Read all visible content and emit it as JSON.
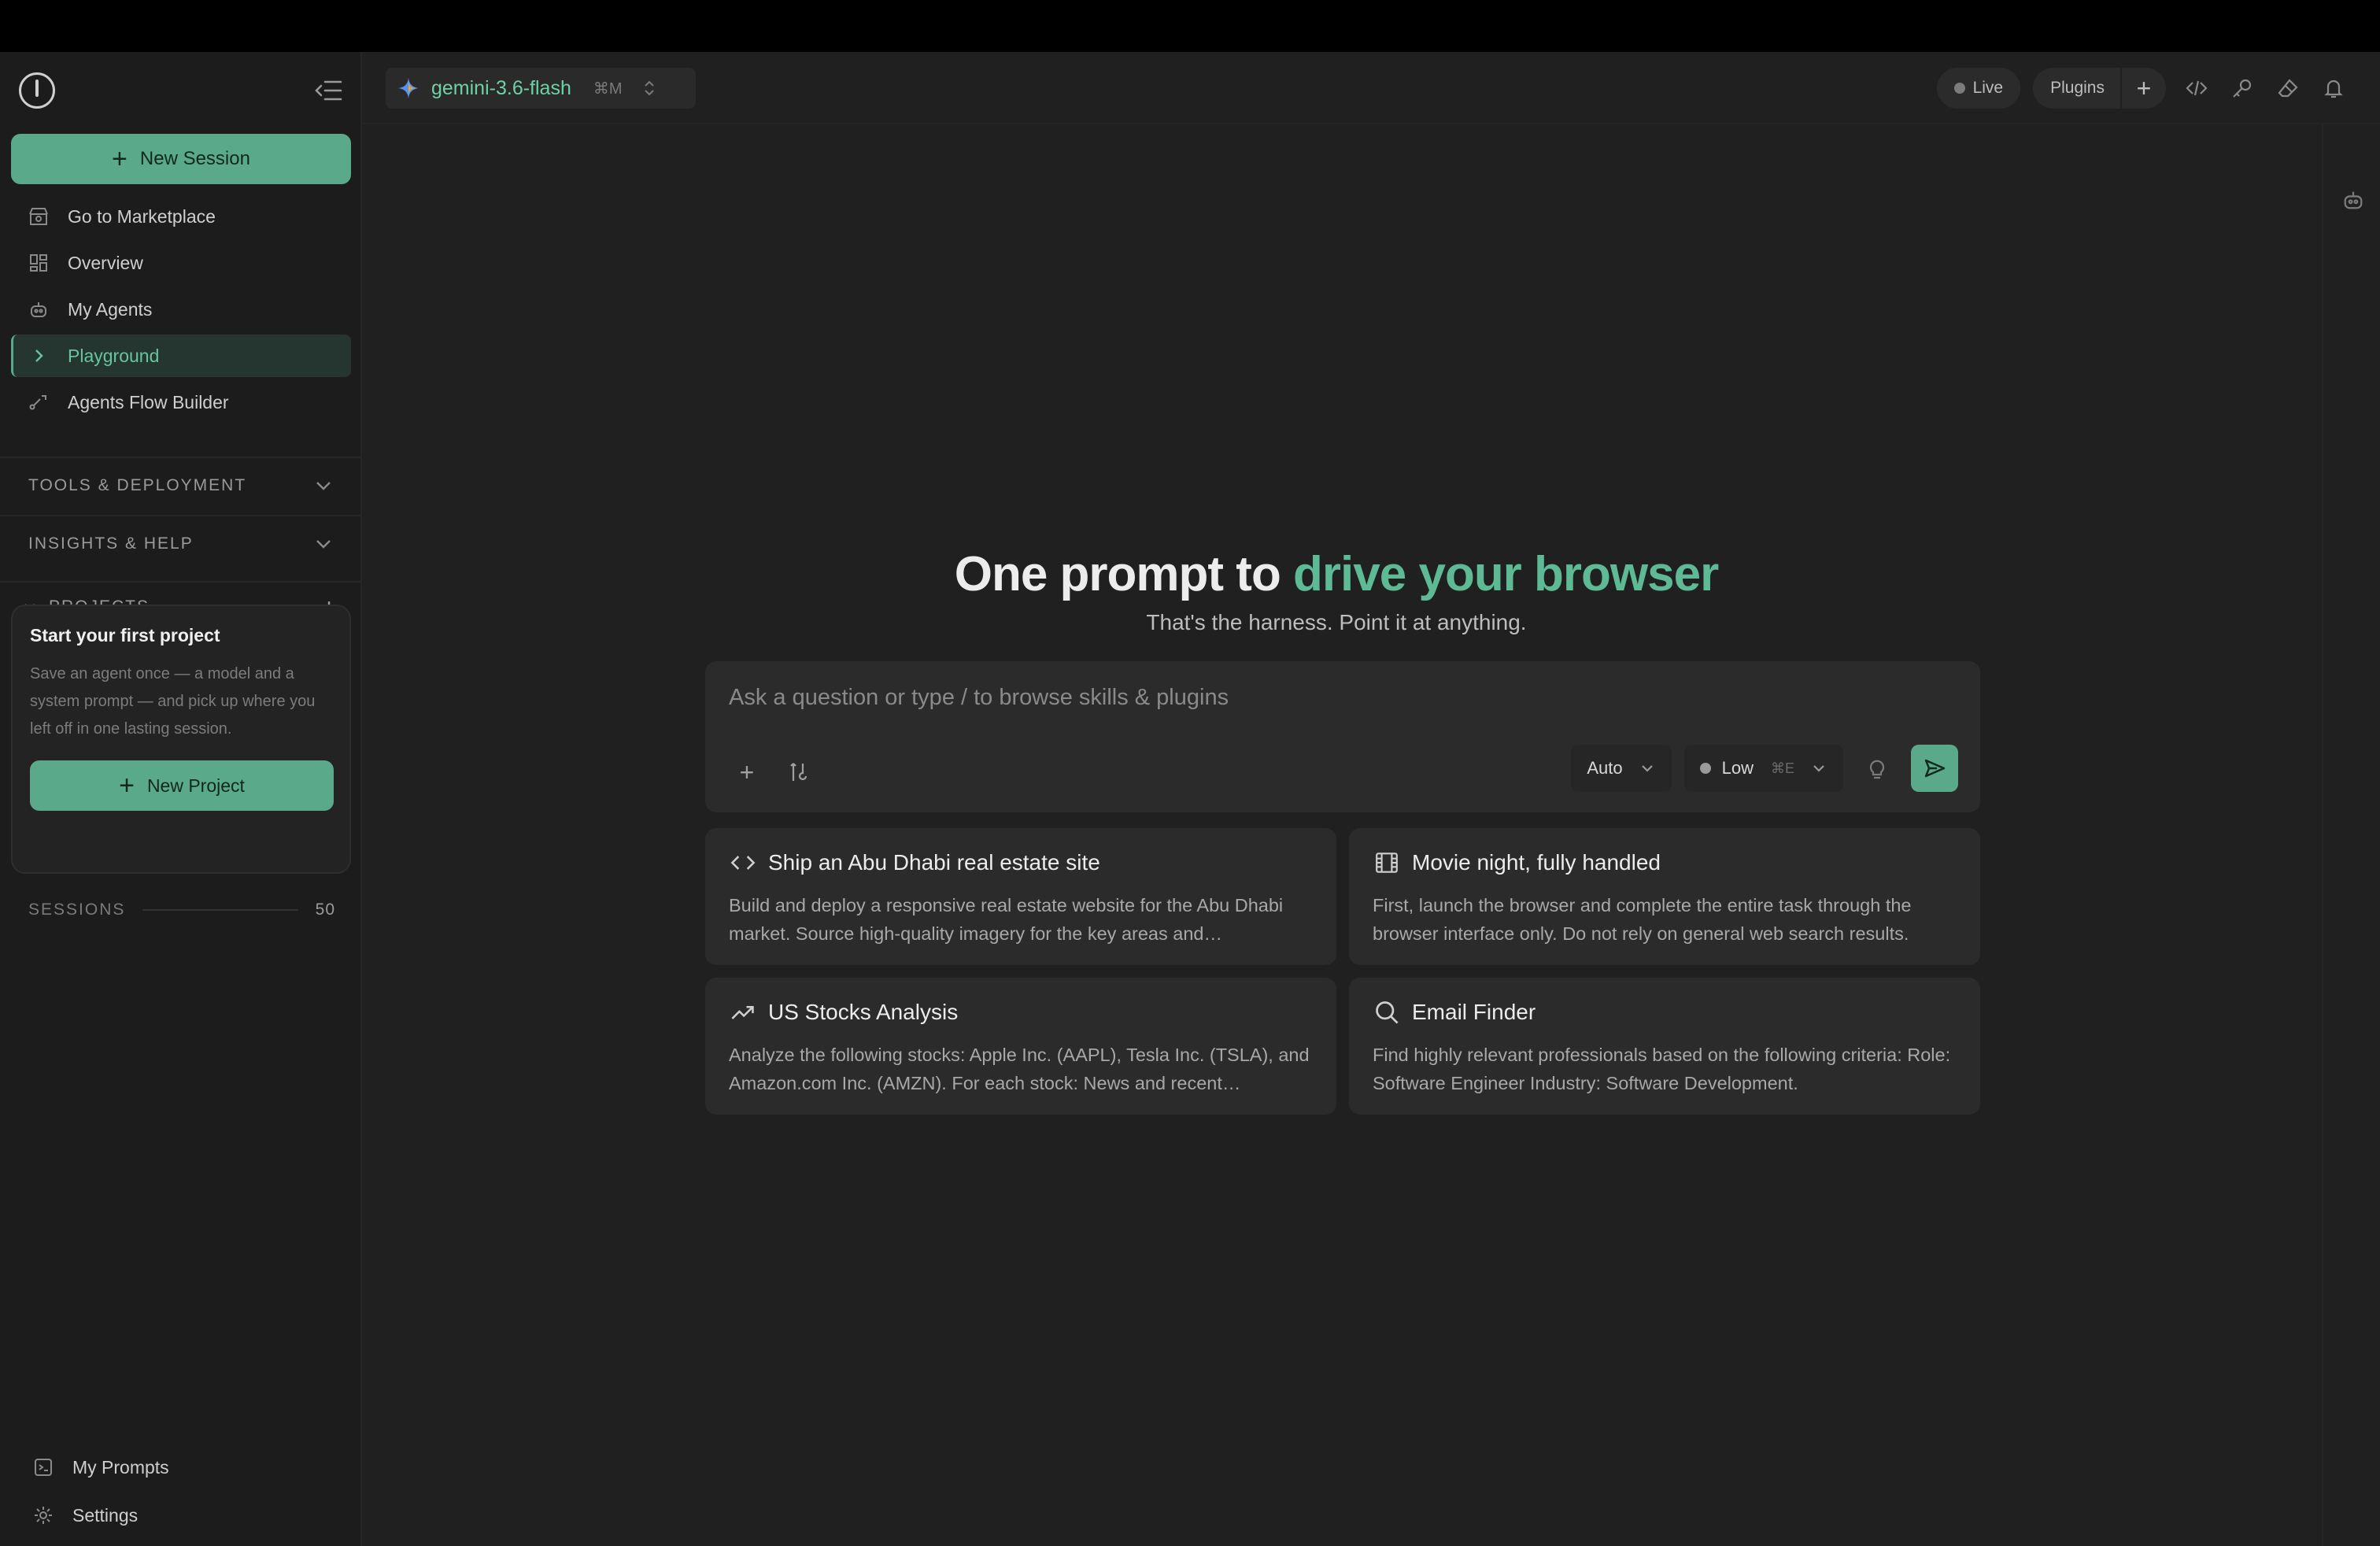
{
  "sidebar": {
    "new_session_label": "New Session",
    "nav": [
      {
        "label": "Go to Marketplace"
      },
      {
        "label": "Overview"
      },
      {
        "label": "My Agents"
      },
      {
        "label": "Playground"
      },
      {
        "label": "Agents Flow Builder"
      }
    ],
    "sections": {
      "tools": "TOOLS & DEPLOYMENT",
      "insights": "INSIGHTS & HELP",
      "projects": "PROJECTS"
    },
    "project_card": {
      "title": "Start your first project",
      "description": "Save an agent once — a model and a system prompt — and pick up where you left off in one lasting session.",
      "button_label": "New Project"
    },
    "sessions": {
      "label": "SESSIONS",
      "count": "50"
    },
    "bottom": [
      {
        "label": "My Prompts"
      },
      {
        "label": "Settings"
      }
    ]
  },
  "header": {
    "model_name": "gemini-3.6-flash",
    "model_shortcut": "⌘M",
    "live_label": "Live",
    "plugins_label": "Plugins"
  },
  "hero": {
    "title_prefix": "One prompt to ",
    "title_accent": "drive your browser",
    "subtitle": "That's the harness. Point it at anything."
  },
  "composer": {
    "placeholder": "Ask a question or type / to browse skills & plugins",
    "mode_value": "Auto",
    "effort_value": "Low",
    "effort_shortcut": "⌘E"
  },
  "cards": [
    {
      "icon": "code-icon",
      "title": "Ship an Abu Dhabi real estate site",
      "description": "Build and deploy a responsive real estate website for the Abu Dhabi market. Source high-quality imagery for the key areas and neighbourhoods."
    },
    {
      "icon": "film-icon",
      "title": "Movie night, fully handled",
      "description": "First, launch the browser and complete the entire task through the browser interface only. Do not rely on general web search results."
    },
    {
      "icon": "trending-up-icon",
      "title": "US Stocks Analysis",
      "description": "Analyze the following stocks: Apple Inc. (AAPL), Tesla Inc. (TSLA), and Amazon.com Inc. (AMZN). For each stock: News and recent performance."
    },
    {
      "icon": "search-icon",
      "title": "Email Finder",
      "description": "Find highly relevant professionals based on the following criteria: Role: Software Engineer Industry: Software Development."
    }
  ],
  "colors": {
    "accent": "#5aa98a",
    "accent_text": "#5dba94",
    "background": "#202020",
    "sidebar": "#1c1c1c"
  }
}
